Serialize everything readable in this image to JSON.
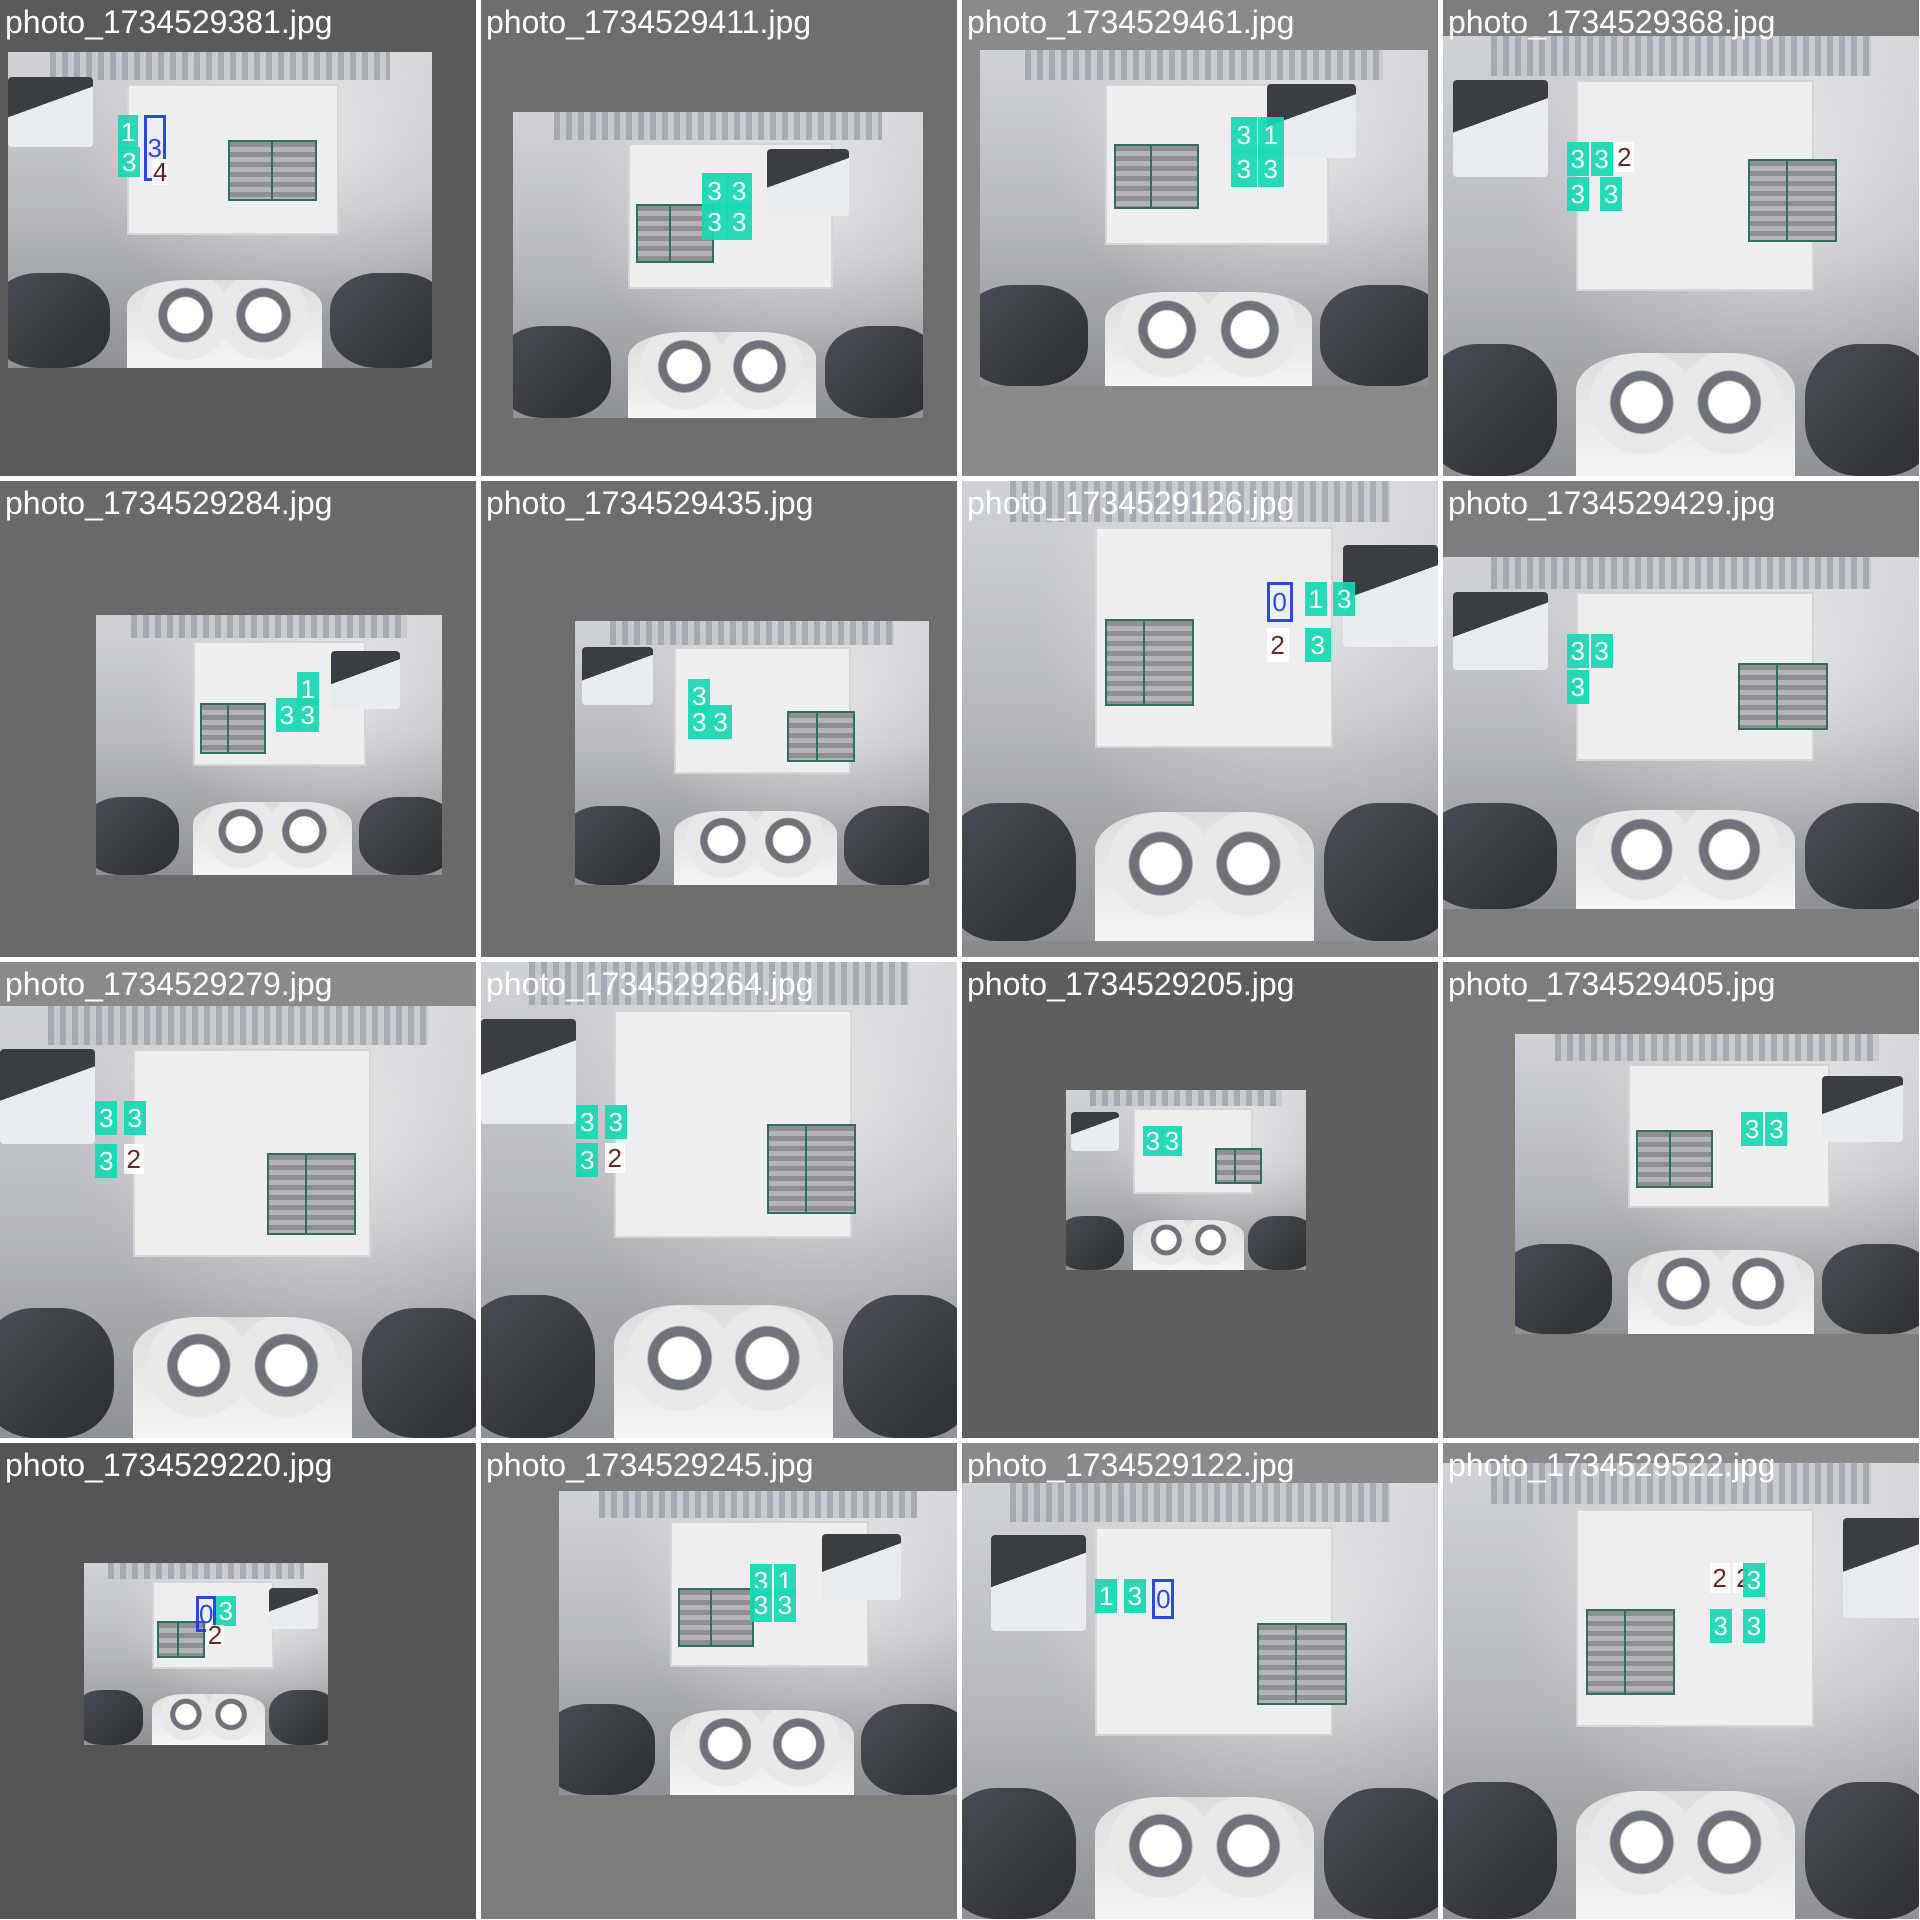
{
  "tiles": [
    {
      "label": "photo_1734529381.jpg",
      "bg": "#5a5a5a"
    },
    {
      "label": "photo_1734529411.jpg",
      "bg": "#6e6e6e"
    },
    {
      "label": "photo_1734529461.jpg",
      "bg": "#8a8a8a"
    },
    {
      "label": "photo_1734529368.jpg",
      "bg": "#7d7d7d"
    },
    {
      "label": "photo_1734529284.jpg",
      "bg": "#6a6a6a"
    },
    {
      "label": "photo_1734529435.jpg",
      "bg": "#6e6e6e"
    },
    {
      "label": "photo_1734529126.jpg",
      "bg": "#8a8a8a"
    },
    {
      "label": "photo_1734529429.jpg",
      "bg": "#7d7d7d"
    },
    {
      "label": "photo_1734529279.jpg",
      "bg": "#8a8a8a"
    },
    {
      "label": "photo_1734529264.jpg",
      "bg": "#8a8a8a"
    },
    {
      "label": "photo_1734529205.jpg",
      "bg": "#5e5e5e"
    },
    {
      "label": "photo_1734529405.jpg",
      "bg": "#7d7d7d"
    },
    {
      "label": "photo_1734529220.jpg",
      "bg": "#555555"
    },
    {
      "label": "photo_1734529245.jpg",
      "bg": "#7d7d7d"
    },
    {
      "label": "photo_1734529122.jpg",
      "bg": "#8a8a8a"
    },
    {
      "label": "photo_1734529522.jpg",
      "bg": "#8a8a8a"
    }
  ],
  "detections": [
    [
      "1",
      "3",
      "3",
      "4"
    ],
    [
      "3",
      "3",
      "3",
      "3"
    ],
    [
      "3",
      "1",
      "3",
      "3"
    ],
    [
      "3",
      "3",
      "2",
      "3",
      "3"
    ],
    [
      "1",
      "3",
      "3"
    ],
    [
      "3",
      "3",
      "3"
    ],
    [
      "0",
      "1",
      "3",
      "2",
      "3"
    ],
    [
      "3",
      "3",
      "3"
    ],
    [
      "3",
      "3",
      "3",
      "2"
    ],
    [
      "3",
      "3",
      "3",
      "2"
    ],
    [
      "3",
      "3"
    ],
    [
      "3",
      "3"
    ],
    [
      "0",
      "3",
      "2"
    ],
    [
      "3",
      "1",
      "3",
      "3"
    ],
    [
      "1",
      "3",
      "0"
    ],
    [
      "2",
      "2",
      "3",
      "3",
      "3"
    ]
  ],
  "colors": {
    "detection": "#18d8b4",
    "detection_blue": "#1b3ae0",
    "label_text": "#ffffff"
  }
}
